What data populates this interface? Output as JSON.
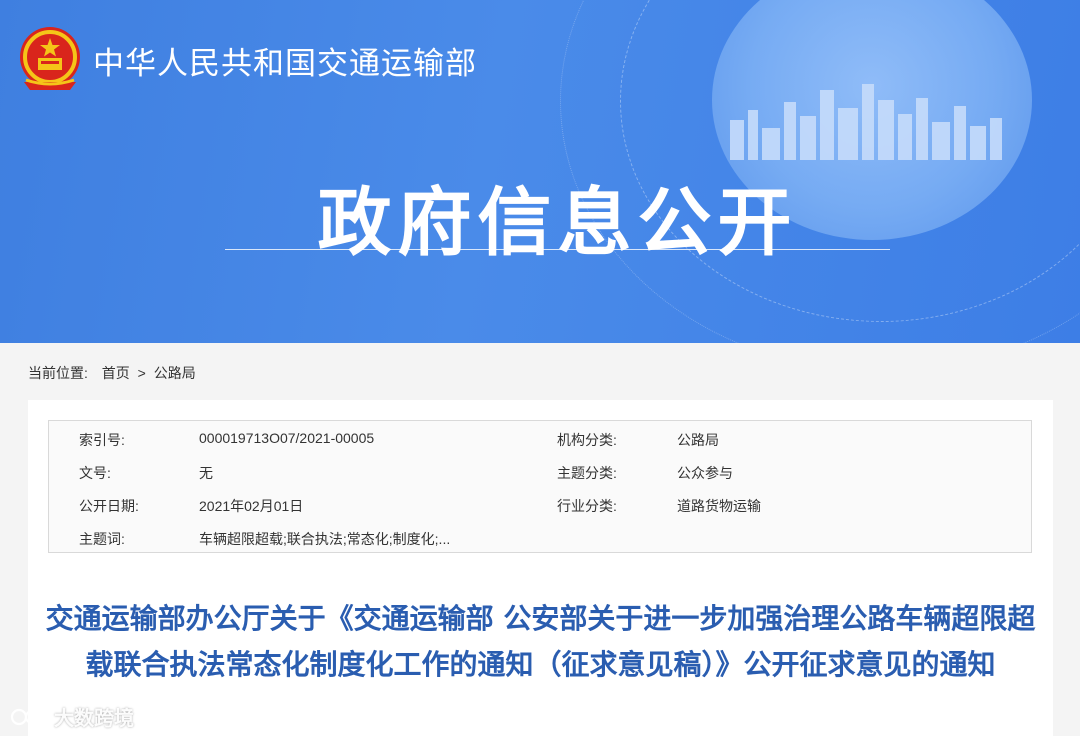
{
  "header": {
    "ministry_name": "中华人民共和国交通运输部",
    "section_title": "政府信息公开"
  },
  "breadcrumb": {
    "label": "当前位置:",
    "items": [
      "首页",
      "公路局"
    ],
    "separator": ">"
  },
  "metadata": {
    "index_no": {
      "label": "索引号:",
      "value": "000019713O07/2021-00005"
    },
    "doc_no": {
      "label": "文号:",
      "value": "无"
    },
    "publish_date": {
      "label": "公开日期:",
      "value": "2021年02月01日"
    },
    "keywords": {
      "label": "主题词:",
      "value": "车辆超限超载;联合执法;常态化;制度化;..."
    },
    "org_category": {
      "label": "机构分类:",
      "value": "公路局"
    },
    "topic_category": {
      "label": "主题分类:",
      "value": "公众参与"
    },
    "industry_category": {
      "label": "行业分类:",
      "value": "道路货物运输"
    }
  },
  "document": {
    "title": "交通运输部办公厅关于《交通运输部 公安部关于进一步加强治理公路车辆超限超载联合执法常态化制度化工作的通知（征求意见稿）》公开征求意见的通知"
  },
  "watermark": {
    "text": "大数跨境"
  },
  "colors": {
    "banner": "#4a8be9",
    "title": "#2a5db0"
  }
}
